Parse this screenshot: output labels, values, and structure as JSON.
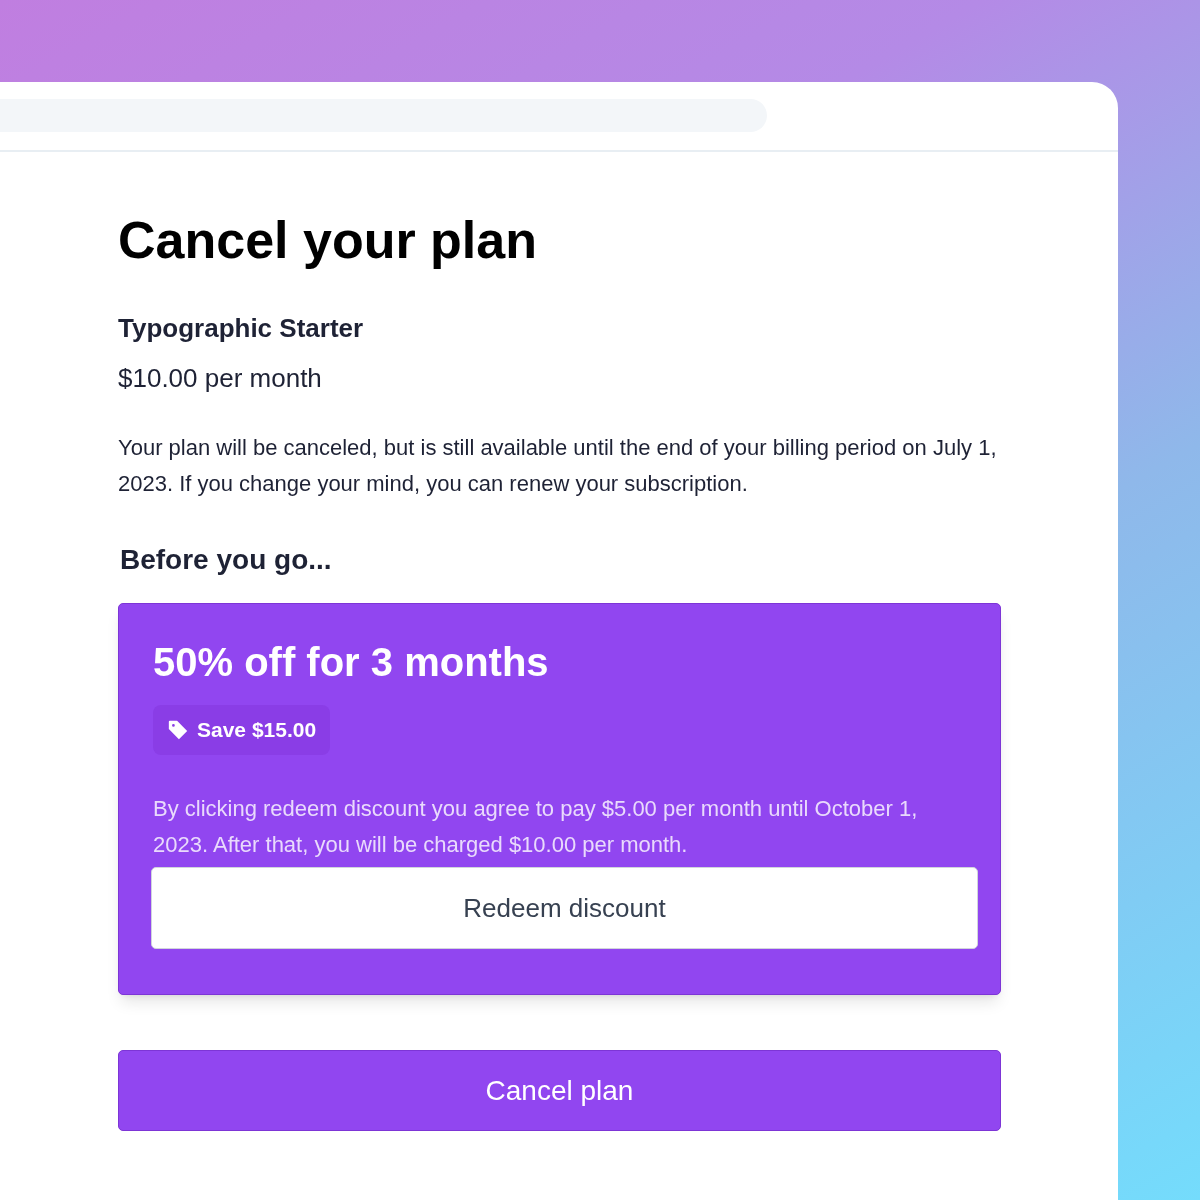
{
  "title": "Cancel your plan",
  "plan": {
    "name": "Typographic Starter",
    "price": "$10.00 per month"
  },
  "notice": "Your plan will be canceled, but is still available until the end of your billing period on July 1, 2023. If you change your mind, you can renew your subscription.",
  "section_title": "Before you go...",
  "offer": {
    "heading": "50% off for 3 months",
    "badge": "Save $15.00",
    "terms": "By clicking redeem discount you agree to pay $5.00 per month until October 1, 2023. After that, you will be charged $10.00 per month.",
    "button": "Redeem discount"
  },
  "cancel_button": "Cancel plan"
}
